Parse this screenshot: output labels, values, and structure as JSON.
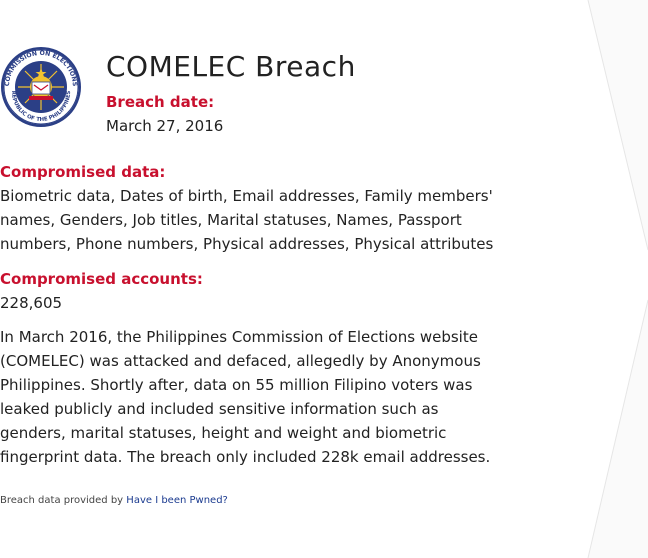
{
  "breach": {
    "title": "COMELEC Breach",
    "date_label": "Breach date:",
    "date_value": "March 27, 2016",
    "data_label": "Compromised data:",
    "data_value": "Biometric data, Dates of birth, Email addresses, Family members' names, Genders, Job titles, Marital statuses, Names, Passport numbers, Phone numbers, Physical addresses, Physical attributes",
    "accounts_label": "Compromised accounts:",
    "accounts_value": "228,605",
    "description": "In March 2016, the Philippines Commission of Elections website (COMELEC) was attacked and defaced, allegedly by Anonymous Philippines. Shortly after, data on 55 million Filipino voters was leaked publicly and included sensitive information such as genders, marital statuses, height and weight and biometric fingerprint data. The breach only included 228k email addresses."
  },
  "logo": {
    "ring_text_top": "COMMISSION ON ELECTIONS",
    "ring_text_bottom": "REPUBLIC OF THE PHILIPPINES"
  },
  "footer": {
    "prefix": "Breach data provided by",
    "link_text": "Have I been Pwned?"
  },
  "colors": {
    "accent": "#c8102e",
    "link": "#1a3a8f"
  }
}
